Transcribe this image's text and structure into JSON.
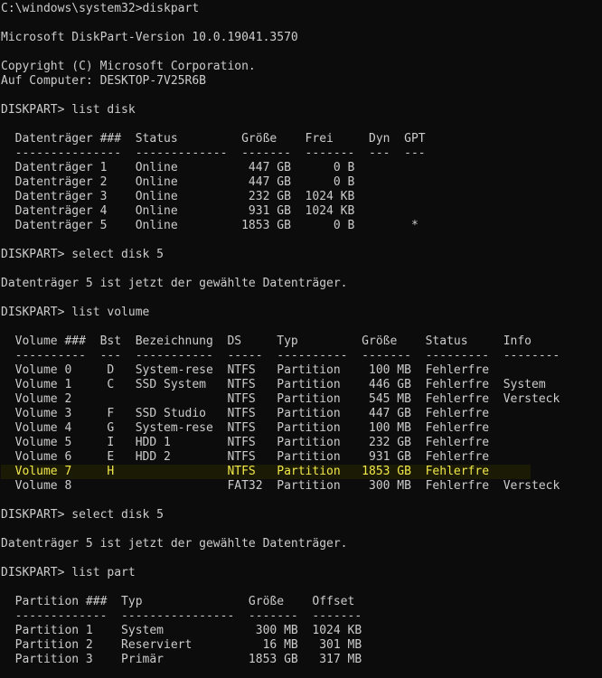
{
  "terminal": {
    "lines": [
      "C:\\windows\\system32>diskpart",
      "",
      "Microsoft DiskPart-Version 10.0.19041.3570",
      "",
      "Copyright (C) Microsoft Corporation.",
      "Auf Computer: DESKTOP-7V25R6B",
      "",
      "DISKPART> list disk",
      "",
      "  Datenträger ###  Status         Größe    Frei     Dyn  GPT",
      "  ---------------  -------------  -------  -------  ---  ---",
      "  Datenträger 1    Online          447 GB      0 B",
      "  Datenträger 2    Online          447 GB      0 B",
      "  Datenträger 3    Online          232 GB  1024 KB",
      "  Datenträger 4    Online          931 GB  1024 KB",
      "  Datenträger 5    Online         1853 GB      0 B        *",
      "",
      "DISKPART> select disk 5",
      "",
      "Datenträger 5 ist jetzt der gewählte Datenträger.",
      "",
      "DISKPART> list volume",
      "",
      "  Volume ###  Bst  Bezeichnung  DS     Typ         Größe    Status     Info",
      "  ----------  ---  -----------  -----  ----------  -------  ---------  --------",
      "  Volume 0     D   System-rese  NTFS   Partition    100 MB  Fehlerfre",
      "  Volume 1     C   SSD System   NTFS   Partition    446 GB  Fehlerfre  System",
      "  Volume 2                      NTFS   Partition    545 MB  Fehlerfre  Versteck",
      "  Volume 3     F   SSD Studio   NTFS   Partition    447 GB  Fehlerfre",
      "  Volume 4     G   System-rese  NTFS   Partition    100 MB  Fehlerfre",
      "  Volume 5     I   HDD 1        NTFS   Partition    232 GB  Fehlerfre",
      "  Volume 6     E   HDD 2        NTFS   Partition    931 GB  Fehlerfre",
      "  Volume 7     H                NTFS   Partition   1853 GB  Fehlerfre",
      "  Volume 8                      FAT32  Partition    300 MB  Fehlerfre  Versteck",
      "",
      "DISKPART> select disk 5",
      "",
      "Datenträger 5 ist jetzt der gewählte Datenträger.",
      "",
      "DISKPART> list part",
      "",
      "  Partition ###  Typ               Größe    Offset",
      "  -------------  ----------------  -------  -------",
      "  Partition 1    System             300 MB  1024 KB",
      "  Partition 2    Reserviert          16 MB   301 MB",
      "  Partition 3    Primär            1853 GB   317 MB"
    ],
    "colors": {
      "background": "#0c0c0c",
      "text": "#cccccc",
      "highlight": "#f3e94a"
    }
  }
}
